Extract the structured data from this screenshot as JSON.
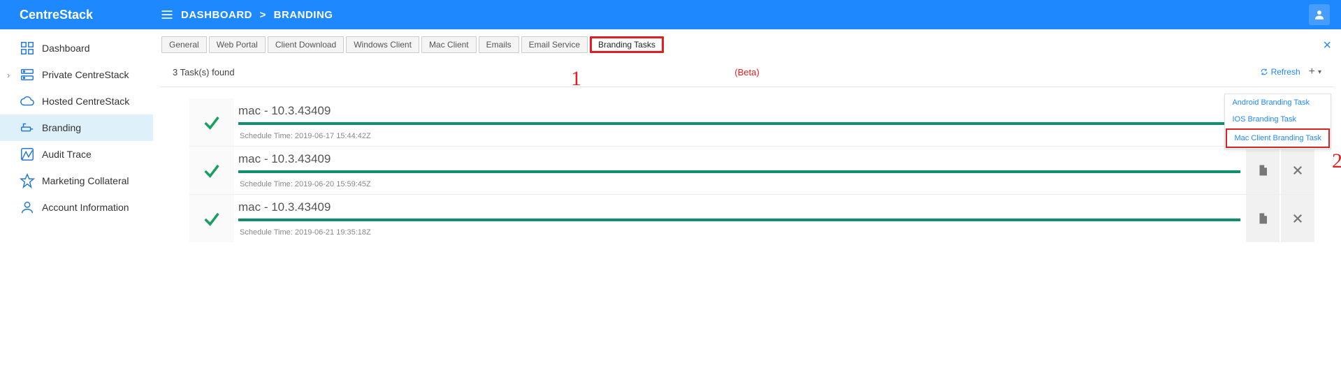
{
  "brand": "CentreStack",
  "breadcrumb": {
    "a": "DASHBOARD",
    "sep": ">",
    "b": "BRANDING"
  },
  "sidebar": {
    "items": [
      {
        "label": "Dashboard"
      },
      {
        "label": "Private CentreStack"
      },
      {
        "label": "Hosted CentreStack"
      },
      {
        "label": "Branding"
      },
      {
        "label": "Audit Trace"
      },
      {
        "label": "Marketing Collateral"
      },
      {
        "label": "Account Information"
      }
    ]
  },
  "tabs": {
    "items": [
      "General",
      "Web Portal",
      "Client Download",
      "Windows Client",
      "Mac Client",
      "Emails",
      "Email Service",
      "Branding Tasks"
    ],
    "active_index": 7
  },
  "status": {
    "found": "3 Task(s) found",
    "beta": "(Beta)",
    "refresh": "Refresh"
  },
  "dropdown": {
    "items": [
      "Android Branding Task",
      "IOS Branding Task",
      "Mac Client Branding Task"
    ]
  },
  "annotations": {
    "a1": "1",
    "a2": "2"
  },
  "tasks": [
    {
      "title": "mac - 10.3.43409",
      "time": "Schedule Time: 2019-06-17 15:44:42Z",
      "actions": false
    },
    {
      "title": "mac - 10.3.43409",
      "time": "Schedule Time: 2019-06-20 15:59:45Z",
      "actions": true
    },
    {
      "title": "mac - 10.3.43409",
      "time": "Schedule Time: 2019-06-21 19:35:18Z",
      "actions": true
    }
  ]
}
